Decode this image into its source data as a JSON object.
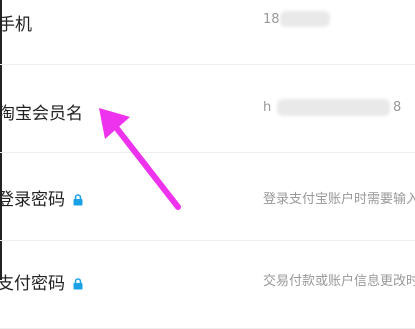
{
  "rows": [
    {
      "label": "手机",
      "value_prefix": "18"
    },
    {
      "label": "淘宝会员名",
      "value_prefix": "h",
      "value_suffix": "8"
    },
    {
      "label": "登录密码",
      "value": "登录支付宝账户时需要输入"
    },
    {
      "label": "支付密码",
      "value": "交易付款或账户信息更改时需"
    }
  ],
  "icons": {
    "lock": "lock-icon",
    "annotation": "arrow-annotation"
  },
  "colors": {
    "lock": "#1aa1e6",
    "arrow": "#ee33ee"
  }
}
